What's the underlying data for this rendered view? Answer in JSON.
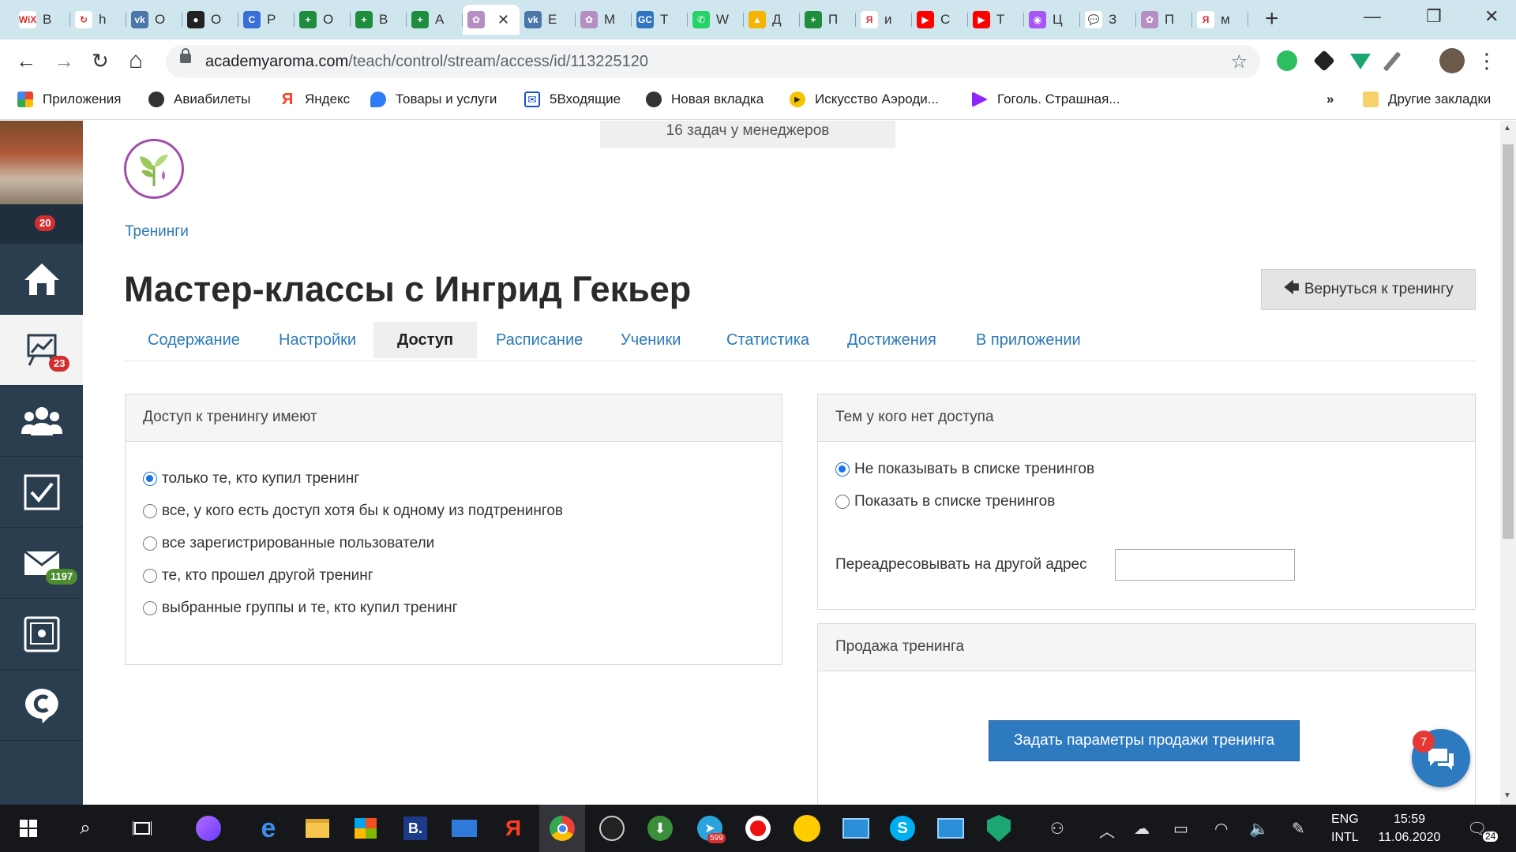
{
  "browser": {
    "tabs": [
      {
        "icon": "wix-icon",
        "icon_text": "WiX",
        "icon_color": "#ffffff",
        "title": "B"
      },
      {
        "icon": "refresh-orange-icon",
        "icon_text": "↻",
        "icon_color": "#ffffff",
        "title": "h"
      },
      {
        "icon": "vk-icon",
        "icon_text": "vk",
        "icon_color": "#4a76a8",
        "title": "O"
      },
      {
        "icon": "record-icon",
        "icon_text": "●",
        "icon_color": "#222222",
        "title": "O"
      },
      {
        "icon": "c-blue-icon",
        "icon_text": "C",
        "icon_color": "#3b6fd8",
        "title": "P"
      },
      {
        "icon": "sheets-plus-icon",
        "icon_text": "+",
        "icon_color": "#1e8e3e",
        "title": "O"
      },
      {
        "icon": "sheets-plus-icon",
        "icon_text": "+",
        "icon_color": "#1e8e3e",
        "title": "B"
      },
      {
        "icon": "sheets-plus-icon",
        "icon_text": "+",
        "icon_color": "#1e8e3e",
        "title": "A"
      },
      {
        "icon": "aroma-icon",
        "icon_text": "✿",
        "icon_color": "#b58ec2",
        "title": "",
        "active": true
      },
      {
        "icon": "vk-icon",
        "icon_text": "vk",
        "icon_color": "#4a76a8",
        "title": "E"
      },
      {
        "icon": "aroma-icon",
        "icon_text": "✿",
        "icon_color": "#b58ec2",
        "title": "M"
      },
      {
        "icon": "gc-icon",
        "icon_text": "GC",
        "icon_color": "#3174c0",
        "title": "T"
      },
      {
        "icon": "whatsapp-icon",
        "icon_text": "✆",
        "icon_color": "#25d366",
        "title": "W"
      },
      {
        "icon": "drive-icon",
        "icon_text": "▲",
        "icon_color": "#f4b400",
        "title": "Д"
      },
      {
        "icon": "sheets-plus-icon",
        "icon_text": "+",
        "icon_color": "#1e8e3e",
        "title": "П"
      },
      {
        "icon": "yandex-icon",
        "icon_text": "Я",
        "icon_color": "#ffffff",
        "title": "и"
      },
      {
        "icon": "youtube-icon",
        "icon_text": "▶",
        "icon_color": "#ff0000",
        "title": "C"
      },
      {
        "icon": "youtube-icon",
        "icon_text": "▶",
        "icon_color": "#ff0000",
        "title": "T"
      },
      {
        "icon": "color-wheel-icon",
        "icon_text": "◉",
        "icon_color": "#a855f7",
        "title": "Ц"
      },
      {
        "icon": "chat-bubbles-icon",
        "icon_text": "💬",
        "icon_color": "#ffffff",
        "title": "З"
      },
      {
        "icon": "aroma-icon",
        "icon_text": "✿",
        "icon_color": "#b58ec2",
        "title": "П"
      },
      {
        "icon": "yandex-icon",
        "icon_text": "Я",
        "icon_color": "#ffffff",
        "title": "м"
      }
    ],
    "active_tab_close": "✕",
    "new_tab": "+",
    "window_controls": {
      "minimize": "—",
      "restore": "❐",
      "close": "✕"
    },
    "nav": {
      "back": "←",
      "forward": "→",
      "reload": "↻",
      "home": "⌂"
    },
    "url_host": "academyaroma.com",
    "url_path": "/teach/control/stream/access/id/113225120",
    "star": "☆",
    "bookmarks": [
      {
        "icon": "apps-grid-icon",
        "label": "Приложения"
      },
      {
        "icon": "globe-icon",
        "label": "Авиабилеты"
      },
      {
        "icon": "yandex-icon",
        "label": "Яндекс"
      },
      {
        "icon": "drops-icon",
        "label": "Товары и услуги"
      },
      {
        "icon": "mail-box-icon",
        "label": "5Входящие"
      },
      {
        "icon": "globe-icon",
        "label": "Новая вкладка"
      },
      {
        "icon": "play-yellow-icon",
        "label": "Искусство Аэроди..."
      },
      {
        "icon": "purple-flag-icon",
        "label": "Гоголь. Страшная..."
      }
    ],
    "bookmarks_more": "»",
    "other_bookmarks": "Другие закладки"
  },
  "sidebar": {
    "notifications_badge": "20",
    "stats_badge": "23",
    "mail_badge": "1197"
  },
  "page": {
    "tasks_banner": "16 задач у менеджеров",
    "breadcrumb": "Тренинги",
    "title": "Мастер-классы с Ингрид Гекьер",
    "back_button": "Вернуться к тренингу",
    "tabs": [
      "Содержание",
      "Настройки",
      "Доступ",
      "Расписание",
      "Ученики",
      "Статистика",
      "Достижения",
      "В приложении"
    ],
    "active_tab": "Доступ",
    "access_panel": {
      "title": "Доступ к тренингу имеют",
      "options": [
        {
          "label": "только те, кто купил тренинг",
          "checked": true
        },
        {
          "label": "все, у кого есть доступ хотя бы к одному из подтренингов",
          "checked": false
        },
        {
          "label": "все зарегистрированные пользователи",
          "checked": false
        },
        {
          "label": "те, кто прошел другой тренинг",
          "checked": false
        },
        {
          "label": "выбранные группы и те, кто купил тренинг",
          "checked": false
        }
      ]
    },
    "no_access_panel": {
      "title": "Тем у кого нет доступа",
      "options": [
        {
          "label": "Не показывать в списке тренингов",
          "checked": true
        },
        {
          "label": "Показать в списке тренингов",
          "checked": false
        }
      ],
      "redirect_label": "Переадресовывать на другой адрес",
      "redirect_value": ""
    },
    "sale_panel": {
      "title": "Продажа тренинга",
      "button": "Задать параметры продажи тренинга"
    },
    "chat_badge": "7"
  },
  "taskbar": {
    "telegram_badge": "599",
    "notifications_badge": "24",
    "lang_top": "ENG",
    "lang_bottom": "INTL",
    "time": "15:59",
    "date": "11.06.2020"
  }
}
